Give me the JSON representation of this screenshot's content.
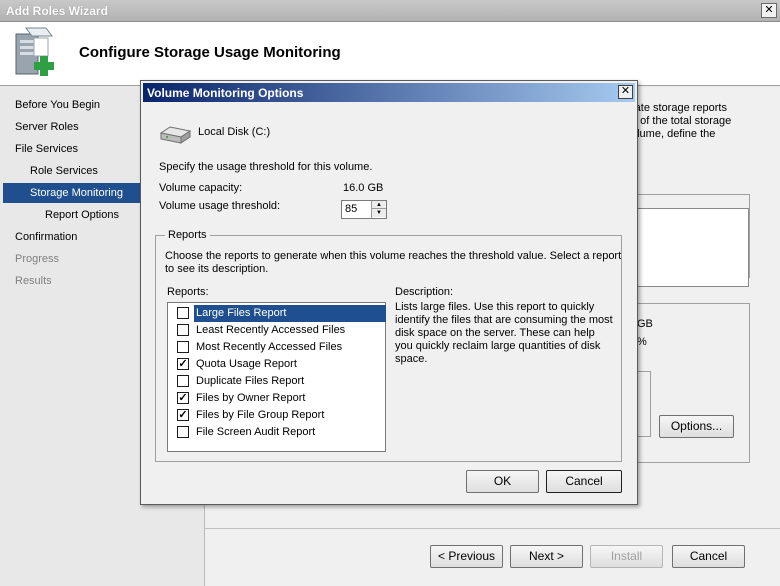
{
  "wizard": {
    "title": "Add Roles Wizard",
    "close_label": "✕",
    "header_title": "Configure Storage Usage Monitoring",
    "nav": [
      {
        "label": "Before You Begin",
        "state": "normal"
      },
      {
        "label": "Server Roles",
        "state": "normal"
      },
      {
        "label": "File Services",
        "state": "normal"
      },
      {
        "label": "Role Services",
        "state": "normal"
      },
      {
        "label": "Storage Monitoring",
        "state": "selected"
      },
      {
        "label": "Report Options",
        "state": "normal"
      },
      {
        "label": "Confirmation",
        "state": "normal"
      },
      {
        "label": "Progress",
        "state": "disabled"
      },
      {
        "label": "Results",
        "state": "disabled"
      }
    ],
    "partial_text": [
      "rate storage reports",
      "e of the total storage",
      "olume, define the"
    ],
    "partial_stat_1": "GB",
    "partial_stat_2": "%",
    "options_button": "Options...",
    "buttons": {
      "previous": "< Previous",
      "next": "Next >",
      "install": "Install",
      "cancel": "Cancel"
    }
  },
  "dialog": {
    "title": "Volume Monitoring Options",
    "close_label": "✕",
    "volume_name": "Local Disk (C:)",
    "instruction": "Specify the usage threshold for this volume.",
    "capacity_label": "Volume capacity:",
    "capacity_value": "16.0 GB",
    "threshold_label": "Volume usage threshold:",
    "threshold_value": "85",
    "reports_group_label": "Reports",
    "reports_instruction_1": "Choose the reports to generate when this volume reaches the threshold value. Select a report",
    "reports_instruction_2": "to see its description.",
    "reports_list_label": "Reports:",
    "reports": [
      {
        "label": "Large Files Report",
        "checked": false,
        "selected": true
      },
      {
        "label": "Least Recently Accessed Files",
        "checked": false,
        "selected": false
      },
      {
        "label": "Most Recently Accessed Files",
        "checked": false,
        "selected": false
      },
      {
        "label": "Quota Usage Report",
        "checked": true,
        "selected": false
      },
      {
        "label": "Duplicate Files Report",
        "checked": false,
        "selected": false
      },
      {
        "label": "Files by Owner Report",
        "checked": true,
        "selected": false
      },
      {
        "label": "Files by File Group Report",
        "checked": true,
        "selected": false
      },
      {
        "label": "File Screen Audit Report",
        "checked": false,
        "selected": false
      }
    ],
    "description_label": "Description:",
    "description_text": "Lists large files. Use this report to quickly identify the files that are consuming the most disk space on the server. These can help you quickly reclaim large quantities of disk space.",
    "ok_label": "OK",
    "cancel_label": "Cancel"
  }
}
